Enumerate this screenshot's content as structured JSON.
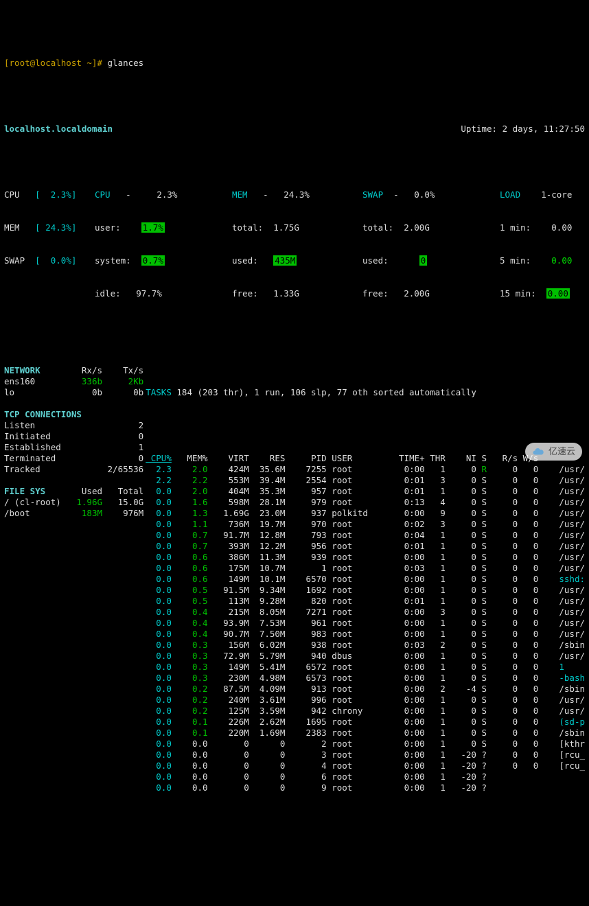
{
  "prompt": {
    "user_host": "[root@localhost ~]#",
    "command": "glances"
  },
  "hostname": "localhost.localdomain",
  "uptime": "Uptime: 2 days, 11:27:50",
  "summary": {
    "left": {
      "cpu_label": "CPU",
      "cpu_val": "[  2.3%]",
      "mem_label": "MEM",
      "mem_val": "[ 24.3%]",
      "swap_label": "SWAP",
      "swap_val": "[  0.0%]"
    },
    "cpu": {
      "title": "CPU",
      "dash": "-",
      "pct": "2.3%",
      "user_l": "user:",
      "user_v": "1.7%",
      "sys_l": "system:",
      "sys_v": "0.7%",
      "idle_l": "idle:",
      "idle_v": "97.7%"
    },
    "mem": {
      "title": "MEM",
      "dash": "-",
      "pct": "24.3%",
      "total_l": "total:",
      "total_v": "1.75G",
      "used_l": "used:",
      "used_v": "435M",
      "free_l": "free:",
      "free_v": "1.33G"
    },
    "swap": {
      "title": "SWAP",
      "dash": "-",
      "pct": "0.0%",
      "total_l": "total:",
      "total_v": "2.00G",
      "used_l": "used:",
      "used_v": "0",
      "free_l": "free:",
      "free_v": "2.00G"
    },
    "load": {
      "title": "LOAD",
      "core": "1-core",
      "m1_l": "1 min:",
      "m1_v": "0.00",
      "m5_l": "5 min:",
      "m5_v": "0.00",
      "m15_l": "15 min:",
      "m15_v": "0.00"
    }
  },
  "network": {
    "title": "NETWORK",
    "rx": "Rx/s",
    "tx": "Tx/s",
    "rows": [
      {
        "if": "ens160",
        "rx": "336b",
        "tx": "2Kb",
        "color": "green"
      },
      {
        "if": "lo",
        "rx": "0b",
        "tx": "0b",
        "color": ""
      }
    ]
  },
  "tcp": {
    "title": "TCP CONNECTIONS",
    "rows": [
      {
        "k": "Listen",
        "v": "2"
      },
      {
        "k": "Initiated",
        "v": "0"
      },
      {
        "k": "Established",
        "v": "1"
      },
      {
        "k": "Terminated",
        "v": "0"
      },
      {
        "k": "Tracked",
        "v": "2/65536"
      }
    ]
  },
  "fs": {
    "title": "FILE SYS",
    "used": "Used",
    "total": "Total",
    "rows": [
      {
        "mnt": "/ (cl-root)",
        "used": "1.96G",
        "total": "15.0G",
        "c": "green"
      },
      {
        "mnt": "/boot",
        "used": "183M",
        "total": "976M",
        "c": "green"
      }
    ]
  },
  "tasks": "184 (203 thr), 1 run, 106 slp, 77 oth sorted automatically",
  "tasks_label": "TASKS",
  "proc_head": {
    "cpu": "CPU%",
    "mem": "MEM%",
    "virt": "VIRT",
    "res": "RES",
    "pid": "PID",
    "user": "USER",
    "time": "TIME+",
    "thr": "THR",
    "ni": "NI",
    "s": "S",
    "rs": "R/s",
    "ws": "W/s"
  },
  "procs": [
    {
      "cpu": "2.3",
      "mem": "2.0",
      "virt": "424M",
      "res": "35.6M",
      "pid": "7255",
      "user": "root",
      "time": "0:00",
      "thr": "1",
      "ni": "0",
      "s": "R",
      "rs": "0",
      "ws": "0",
      "cmd": "/usr/",
      "mc": "green",
      "sc": "green"
    },
    {
      "cpu": "2.2",
      "mem": "2.2",
      "virt": "553M",
      "res": "39.4M",
      "pid": "2554",
      "user": "root",
      "time": "0:01",
      "thr": "3",
      "ni": "0",
      "s": "S",
      "rs": "0",
      "ws": "0",
      "cmd": "/usr/",
      "mc": "green"
    },
    {
      "cpu": "0.0",
      "mem": "2.0",
      "virt": "404M",
      "res": "35.3M",
      "pid": "957",
      "user": "root",
      "time": "0:01",
      "thr": "1",
      "ni": "0",
      "s": "S",
      "rs": "0",
      "ws": "0",
      "cmd": "/usr/",
      "mc": "green"
    },
    {
      "cpu": "0.0",
      "mem": "1.6",
      "virt": "598M",
      "res": "28.1M",
      "pid": "979",
      "user": "root",
      "time": "0:13",
      "thr": "4",
      "ni": "0",
      "s": "S",
      "rs": "0",
      "ws": "0",
      "cmd": "/usr/",
      "mc": "green"
    },
    {
      "cpu": "0.0",
      "mem": "1.3",
      "virt": "1.69G",
      "res": "23.0M",
      "pid": "937",
      "user": "polkitd",
      "time": "0:00",
      "thr": "9",
      "ni": "0",
      "s": "S",
      "rs": "0",
      "ws": "0",
      "cmd": "/usr/",
      "mc": "green"
    },
    {
      "cpu": "0.0",
      "mem": "1.1",
      "virt": "736M",
      "res": "19.7M",
      "pid": "970",
      "user": "root",
      "time": "0:02",
      "thr": "3",
      "ni": "0",
      "s": "S",
      "rs": "0",
      "ws": "0",
      "cmd": "/usr/",
      "mc": "green"
    },
    {
      "cpu": "0.0",
      "mem": "0.7",
      "virt": "91.7M",
      "res": "12.8M",
      "pid": "793",
      "user": "root",
      "time": "0:04",
      "thr": "1",
      "ni": "0",
      "s": "S",
      "rs": "0",
      "ws": "0",
      "cmd": "/usr/",
      "mc": "green"
    },
    {
      "cpu": "0.0",
      "mem": "0.7",
      "virt": "393M",
      "res": "12.2M",
      "pid": "956",
      "user": "root",
      "time": "0:01",
      "thr": "1",
      "ni": "0",
      "s": "S",
      "rs": "0",
      "ws": "0",
      "cmd": "/usr/",
      "mc": "green"
    },
    {
      "cpu": "0.0",
      "mem": "0.6",
      "virt": "386M",
      "res": "11.3M",
      "pid": "939",
      "user": "root",
      "time": "0:00",
      "thr": "1",
      "ni": "0",
      "s": "S",
      "rs": "0",
      "ws": "0",
      "cmd": "/usr/",
      "mc": "green"
    },
    {
      "cpu": "0.0",
      "mem": "0.6",
      "virt": "175M",
      "res": "10.7M",
      "pid": "1",
      "user": "root",
      "time": "0:03",
      "thr": "1",
      "ni": "0",
      "s": "S",
      "rs": "0",
      "ws": "0",
      "cmd": "/usr/",
      "mc": "green"
    },
    {
      "cpu": "0.0",
      "mem": "0.6",
      "virt": "149M",
      "res": "10.1M",
      "pid": "6570",
      "user": "root",
      "time": "0:00",
      "thr": "1",
      "ni": "0",
      "s": "S",
      "rs": "0",
      "ws": "0",
      "cmd": "sshd:",
      "mc": "green",
      "cc": "cyan"
    },
    {
      "cpu": "0.0",
      "mem": "0.5",
      "virt": "91.5M",
      "res": "9.34M",
      "pid": "1692",
      "user": "root",
      "time": "0:00",
      "thr": "1",
      "ni": "0",
      "s": "S",
      "rs": "0",
      "ws": "0",
      "cmd": "/usr/",
      "mc": "green"
    },
    {
      "cpu": "0.0",
      "mem": "0.5",
      "virt": "113M",
      "res": "9.28M",
      "pid": "820",
      "user": "root",
      "time": "0:01",
      "thr": "1",
      "ni": "0",
      "s": "S",
      "rs": "0",
      "ws": "0",
      "cmd": "/usr/",
      "mc": "green"
    },
    {
      "cpu": "0.0",
      "mem": "0.4",
      "virt": "215M",
      "res": "8.05M",
      "pid": "7271",
      "user": "root",
      "time": "0:00",
      "thr": "3",
      "ni": "0",
      "s": "S",
      "rs": "0",
      "ws": "0",
      "cmd": "/usr/",
      "mc": "green"
    },
    {
      "cpu": "0.0",
      "mem": "0.4",
      "virt": "93.9M",
      "res": "7.53M",
      "pid": "961",
      "user": "root",
      "time": "0:00",
      "thr": "1",
      "ni": "0",
      "s": "S",
      "rs": "0",
      "ws": "0",
      "cmd": "/usr/",
      "mc": "green"
    },
    {
      "cpu": "0.0",
      "mem": "0.4",
      "virt": "90.7M",
      "res": "7.50M",
      "pid": "983",
      "user": "root",
      "time": "0:00",
      "thr": "1",
      "ni": "0",
      "s": "S",
      "rs": "0",
      "ws": "0",
      "cmd": "/usr/",
      "mc": "green"
    },
    {
      "cpu": "0.0",
      "mem": "0.3",
      "virt": "156M",
      "res": "6.02M",
      "pid": "938",
      "user": "root",
      "time": "0:03",
      "thr": "2",
      "ni": "0",
      "s": "S",
      "rs": "0",
      "ws": "0",
      "cmd": "/sbin",
      "mc": "green"
    },
    {
      "cpu": "0.0",
      "mem": "0.3",
      "virt": "72.9M",
      "res": "5.79M",
      "pid": "940",
      "user": "dbus",
      "time": "0:00",
      "thr": "1",
      "ni": "0",
      "s": "S",
      "rs": "0",
      "ws": "0",
      "cmd": "/usr/",
      "mc": "green"
    },
    {
      "cpu": "0.0",
      "mem": "0.3",
      "virt": "149M",
      "res": "5.41M",
      "pid": "6572",
      "user": "root",
      "time": "0:00",
      "thr": "1",
      "ni": "0",
      "s": "S",
      "rs": "0",
      "ws": "0",
      "cmd": "1",
      "mc": "green",
      "cc": "cyan"
    },
    {
      "cpu": "0.0",
      "mem": "0.3",
      "virt": "230M",
      "res": "4.98M",
      "pid": "6573",
      "user": "root",
      "time": "0:00",
      "thr": "1",
      "ni": "0",
      "s": "S",
      "rs": "0",
      "ws": "0",
      "cmd": "-bash",
      "mc": "green",
      "cc": "cyan"
    },
    {
      "cpu": "0.0",
      "mem": "0.2",
      "virt": "87.5M",
      "res": "4.09M",
      "pid": "913",
      "user": "root",
      "time": "0:00",
      "thr": "2",
      "ni": "-4",
      "s": "S",
      "rs": "0",
      "ws": "0",
      "cmd": "/sbin",
      "mc": "green"
    },
    {
      "cpu": "0.0",
      "mem": "0.2",
      "virt": "240M",
      "res": "3.61M",
      "pid": "996",
      "user": "root",
      "time": "0:00",
      "thr": "1",
      "ni": "0",
      "s": "S",
      "rs": "0",
      "ws": "0",
      "cmd": "/usr/",
      "mc": "green"
    },
    {
      "cpu": "0.0",
      "mem": "0.2",
      "virt": "125M",
      "res": "3.59M",
      "pid": "942",
      "user": "chrony",
      "time": "0:00",
      "thr": "1",
      "ni": "0",
      "s": "S",
      "rs": "0",
      "ws": "0",
      "cmd": "/usr/",
      "mc": "green"
    },
    {
      "cpu": "0.0",
      "mem": "0.1",
      "virt": "226M",
      "res": "2.62M",
      "pid": "1695",
      "user": "root",
      "time": "0:00",
      "thr": "1",
      "ni": "0",
      "s": "S",
      "rs": "0",
      "ws": "0",
      "cmd": "(sd-p",
      "mc": "green",
      "cc": "cyan"
    },
    {
      "cpu": "0.0",
      "mem": "0.1",
      "virt": "220M",
      "res": "1.69M",
      "pid": "2383",
      "user": "root",
      "time": "0:00",
      "thr": "1",
      "ni": "0",
      "s": "S",
      "rs": "0",
      "ws": "0",
      "cmd": "/sbin",
      "mc": "green"
    },
    {
      "cpu": "0.0",
      "mem": "0.0",
      "virt": "0",
      "res": "0",
      "pid": "2",
      "user": "root",
      "time": "0:00",
      "thr": "1",
      "ni": "0",
      "s": "S",
      "rs": "0",
      "ws": "0",
      "cmd": "[kthr"
    },
    {
      "cpu": "0.0",
      "mem": "0.0",
      "virt": "0",
      "res": "0",
      "pid": "3",
      "user": "root",
      "time": "0:00",
      "thr": "1",
      "ni": "-20",
      "s": "?",
      "rs": "0",
      "ws": "0",
      "cmd": "[rcu_"
    },
    {
      "cpu": "0.0",
      "mem": "0.0",
      "virt": "0",
      "res": "0",
      "pid": "4",
      "user": "root",
      "time": "0:00",
      "thr": "1",
      "ni": "-20",
      "s": "?",
      "rs": "0",
      "ws": "0",
      "cmd": "[rcu_"
    },
    {
      "cpu": "0.0",
      "mem": "0.0",
      "virt": "0",
      "res": "0",
      "pid": "6",
      "user": "root",
      "time": "0:00",
      "thr": "1",
      "ni": "-20",
      "s": "?",
      "rs": "",
      "ws": "",
      "cmd": ""
    },
    {
      "cpu": "0.0",
      "mem": "0.0",
      "virt": "0",
      "res": "0",
      "pid": "9",
      "user": "root",
      "time": "0:00",
      "thr": "1",
      "ni": "-20",
      "s": "?",
      "rs": "",
      "ws": "",
      "cmd": ""
    }
  ],
  "watermark": "亿速云"
}
